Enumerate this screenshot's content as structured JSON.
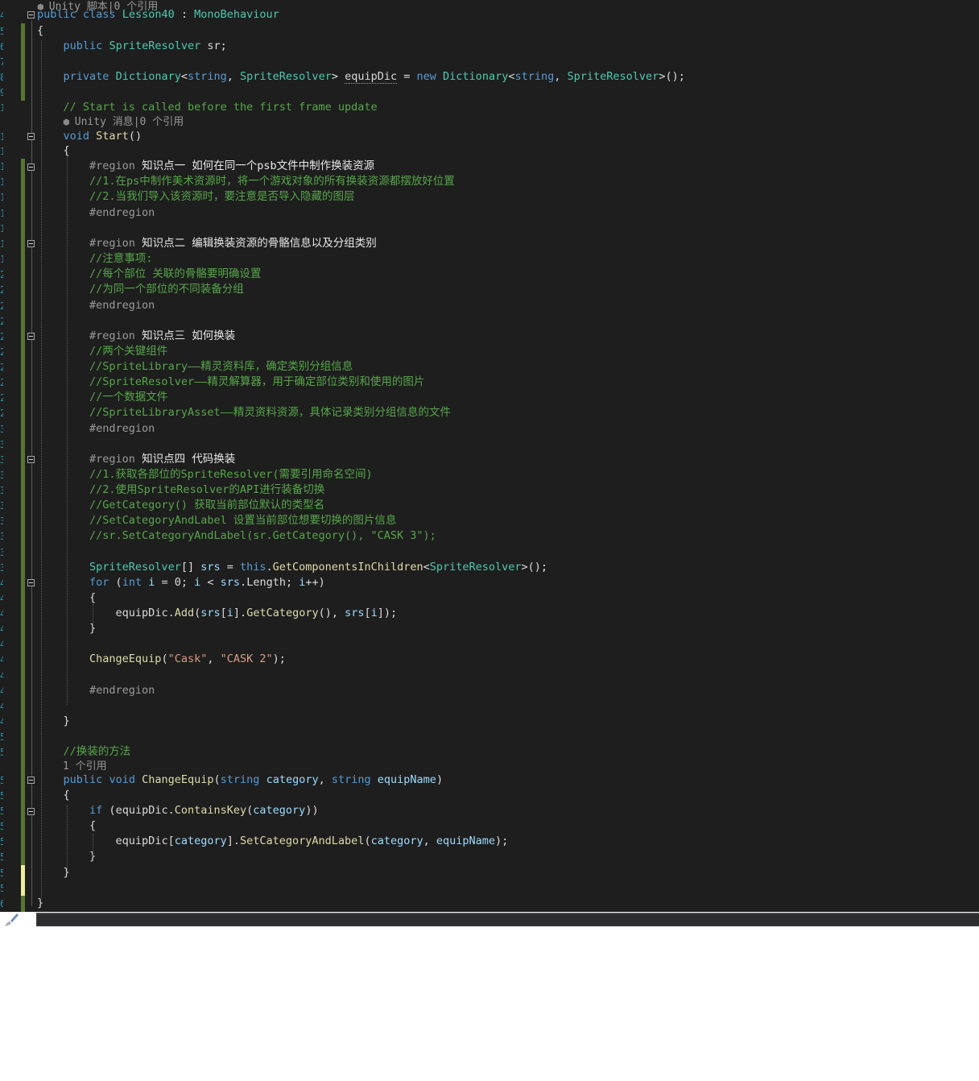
{
  "editor": {
    "language": "C#",
    "theme": "dark",
    "lines": [
      {
        "lens": "Unity 脚本|0 个引用"
      },
      {
        "tokens": [
          [
            "kw",
            "public"
          ],
          [
            "",
            " "
          ],
          [
            "kw",
            "class"
          ],
          [
            "",
            " "
          ],
          [
            "ty",
            "Lesson40"
          ],
          [
            "",
            " : "
          ],
          [
            "ty",
            "MonoBehaviour"
          ]
        ]
      },
      {
        "tokens": [
          [
            "",
            "{"
          ]
        ]
      },
      {
        "tokens": [
          [
            "",
            "    "
          ],
          [
            "kw",
            "public"
          ],
          [
            "",
            " "
          ],
          [
            "ty",
            "SpriteResolver"
          ],
          [
            "",
            " "
          ],
          [
            "fd",
            "sr"
          ],
          [
            "",
            ";"
          ]
        ]
      },
      {
        "tokens": []
      },
      {
        "tokens": [
          [
            "",
            "    "
          ],
          [
            "kw",
            "private"
          ],
          [
            "",
            " "
          ],
          [
            "ty",
            "Dictionary"
          ],
          [
            "",
            "<"
          ],
          [
            "kw",
            "string"
          ],
          [
            "",
            ", "
          ],
          [
            "ty",
            "SpriteResolver"
          ],
          [
            "",
            "> "
          ],
          [
            "fd",
            "equipDic"
          ],
          [
            "",
            " = "
          ],
          [
            "kw",
            "new"
          ],
          [
            "",
            " "
          ],
          [
            "ty",
            "Dictionary"
          ],
          [
            "",
            "<"
          ],
          [
            "kw",
            "string"
          ],
          [
            "",
            ", "
          ],
          [
            "ty",
            "SpriteResolver"
          ],
          [
            "",
            ">();"
          ]
        ]
      },
      {
        "tokens": []
      },
      {
        "tokens": [
          [
            "",
            "    "
          ],
          [
            "cm",
            "// Start is called before the first frame update"
          ]
        ]
      },
      {
        "lens": "Unity 消息|0 个引用"
      },
      {
        "tokens": [
          [
            "",
            "    "
          ],
          [
            "kw",
            "void"
          ],
          [
            "",
            " "
          ],
          [
            "mt",
            "Start"
          ],
          [
            "",
            "()"
          ]
        ]
      },
      {
        "tokens": [
          [
            "",
            "    {"
          ]
        ]
      },
      {
        "tokens": [
          [
            "",
            "        "
          ],
          [
            "pp",
            "#region"
          ],
          [
            "",
            " "
          ],
          [
            "reg",
            "知识点一 如何在同一个psb文件中制作换装资源"
          ]
        ]
      },
      {
        "tokens": [
          [
            "",
            "        "
          ],
          [
            "cm",
            "//1.在ps中制作美术资源时，将一个游戏对象的所有换装资源都摆放好位置"
          ]
        ]
      },
      {
        "tokens": [
          [
            "",
            "        "
          ],
          [
            "cm",
            "//2.当我们导入该资源时，要注意是否导入隐藏的图层"
          ]
        ]
      },
      {
        "tokens": [
          [
            "",
            "        "
          ],
          [
            "pp",
            "#endregion"
          ]
        ]
      },
      {
        "tokens": []
      },
      {
        "tokens": [
          [
            "",
            "        "
          ],
          [
            "pp",
            "#region"
          ],
          [
            "",
            " "
          ],
          [
            "reg",
            "知识点二 编辑换装资源的骨骼信息以及分组类别"
          ]
        ]
      },
      {
        "tokens": [
          [
            "",
            "        "
          ],
          [
            "cm",
            "//注意事项:"
          ]
        ]
      },
      {
        "tokens": [
          [
            "",
            "        "
          ],
          [
            "cm",
            "//每个部位 关联的骨骼要明确设置"
          ]
        ]
      },
      {
        "tokens": [
          [
            "",
            "        "
          ],
          [
            "cm",
            "//为同一个部位的不同装备分组"
          ]
        ]
      },
      {
        "tokens": [
          [
            "",
            "        "
          ],
          [
            "pp",
            "#endregion"
          ]
        ]
      },
      {
        "tokens": []
      },
      {
        "tokens": [
          [
            "",
            "        "
          ],
          [
            "pp",
            "#region"
          ],
          [
            "",
            " "
          ],
          [
            "reg",
            "知识点三 如何换装"
          ]
        ]
      },
      {
        "tokens": [
          [
            "",
            "        "
          ],
          [
            "cm",
            "//两个关键组件"
          ]
        ]
      },
      {
        "tokens": [
          [
            "",
            "        "
          ],
          [
            "cm",
            "//SpriteLibrary——精灵资料库，确定类别分组信息"
          ]
        ]
      },
      {
        "tokens": [
          [
            "",
            "        "
          ],
          [
            "cm",
            "//SpriteResolver——精灵解算器，用于确定部位类别和使用的图片"
          ]
        ]
      },
      {
        "tokens": [
          [
            "",
            "        "
          ],
          [
            "cm",
            "//一个数据文件"
          ]
        ]
      },
      {
        "tokens": [
          [
            "",
            "        "
          ],
          [
            "cm",
            "//SpriteLibraryAsset——精灵资料资源，具体记录类别分组信息的文件"
          ]
        ]
      },
      {
        "tokens": [
          [
            "",
            "        "
          ],
          [
            "pp",
            "#endregion"
          ]
        ]
      },
      {
        "tokens": []
      },
      {
        "tokens": [
          [
            "",
            "        "
          ],
          [
            "pp",
            "#region"
          ],
          [
            "",
            " "
          ],
          [
            "reg",
            "知识点四 代码换装"
          ]
        ]
      },
      {
        "tokens": [
          [
            "",
            "        "
          ],
          [
            "cm",
            "//1.获取各部位的SpriteResolver(需要引用命名空间)"
          ]
        ]
      },
      {
        "tokens": [
          [
            "",
            "        "
          ],
          [
            "cm",
            "//2.使用SpriteResolver的API进行装备切换"
          ]
        ]
      },
      {
        "tokens": [
          [
            "",
            "        "
          ],
          [
            "cm",
            "//GetCategory() 获取当前部位默认的类型名"
          ]
        ]
      },
      {
        "tokens": [
          [
            "",
            "        "
          ],
          [
            "cm",
            "//SetCategoryAndLabel 设置当前部位想要切换的图片信息"
          ]
        ]
      },
      {
        "tokens": [
          [
            "",
            "        "
          ],
          [
            "cm",
            "//sr.SetCategoryAndLabel(sr.GetCategory(), \"CASK 3\");"
          ]
        ]
      },
      {
        "tokens": []
      },
      {
        "tokens": [
          [
            "",
            "        "
          ],
          [
            "ty",
            "SpriteResolver"
          ],
          [
            "",
            "[] "
          ],
          [
            "pa",
            "srs"
          ],
          [
            "",
            " = "
          ],
          [
            "kw",
            "this"
          ],
          [
            "",
            "."
          ],
          [
            "mt",
            "GetComponentsInChildren"
          ],
          [
            "",
            "<"
          ],
          [
            "ty",
            "SpriteResolver"
          ],
          [
            "",
            ">();"
          ]
        ]
      },
      {
        "tokens": [
          [
            "",
            "        "
          ],
          [
            "kw",
            "for"
          ],
          [
            "",
            " ("
          ],
          [
            "kw",
            "int"
          ],
          [
            "",
            " "
          ],
          [
            "pa",
            "i"
          ],
          [
            "",
            " = 0; "
          ],
          [
            "pa",
            "i"
          ],
          [
            "",
            " < "
          ],
          [
            "pa",
            "srs"
          ],
          [
            "",
            ".Length; "
          ],
          [
            "pa",
            "i"
          ],
          [
            "",
            "++)"
          ]
        ]
      },
      {
        "tokens": [
          [
            "",
            "        {"
          ]
        ]
      },
      {
        "tokens": [
          [
            "",
            "            "
          ],
          [
            "fd",
            "equipDic"
          ],
          [
            "",
            "."
          ],
          [
            "mt",
            "Add"
          ],
          [
            "",
            "("
          ],
          [
            "pa",
            "srs"
          ],
          [
            "",
            "["
          ],
          [
            "pa",
            "i"
          ],
          [
            "",
            "]."
          ],
          [
            "mt",
            "GetCategory"
          ],
          [
            "",
            "(), "
          ],
          [
            "pa",
            "srs"
          ],
          [
            "",
            "["
          ],
          [
            "pa",
            "i"
          ],
          [
            "",
            "]);"
          ]
        ]
      },
      {
        "tokens": [
          [
            "",
            "        }"
          ]
        ]
      },
      {
        "tokens": []
      },
      {
        "tokens": [
          [
            "",
            "        "
          ],
          [
            "mt",
            "ChangeEquip"
          ],
          [
            "",
            "("
          ],
          [
            "st",
            "\"Cask\""
          ],
          [
            "",
            ", "
          ],
          [
            "st",
            "\"CASK 2\""
          ],
          [
            "",
            ");"
          ]
        ]
      },
      {
        "tokens": []
      },
      {
        "tokens": [
          [
            "",
            "        "
          ],
          [
            "pp",
            "#endregion"
          ]
        ]
      },
      {
        "tokens": []
      },
      {
        "tokens": [
          [
            "",
            "    }"
          ]
        ]
      },
      {
        "tokens": []
      },
      {
        "tokens": [
          [
            "",
            "    "
          ],
          [
            "cm",
            "//换装的方法"
          ]
        ]
      },
      {
        "lens": "1 个引用"
      },
      {
        "tokens": [
          [
            "",
            "    "
          ],
          [
            "kw",
            "public"
          ],
          [
            "",
            " "
          ],
          [
            "kw",
            "void"
          ],
          [
            "",
            " "
          ],
          [
            "mt",
            "ChangeEquip"
          ],
          [
            "",
            "("
          ],
          [
            "kw",
            "string"
          ],
          [
            "",
            " "
          ],
          [
            "pa",
            "category"
          ],
          [
            "",
            ", "
          ],
          [
            "kw",
            "string"
          ],
          [
            "",
            " "
          ],
          [
            "pa",
            "equipName"
          ],
          [
            "",
            ")"
          ]
        ]
      },
      {
        "tokens": [
          [
            "",
            "    {"
          ]
        ]
      },
      {
        "tokens": [
          [
            "",
            "        "
          ],
          [
            "kw",
            "if"
          ],
          [
            "",
            " ("
          ],
          [
            "fd",
            "equipDic"
          ],
          [
            "",
            "."
          ],
          [
            "mt",
            "ContainsKey"
          ],
          [
            "",
            "("
          ],
          [
            "pa",
            "category"
          ],
          [
            "",
            "))"
          ]
        ]
      },
      {
        "tokens": [
          [
            "",
            "        {"
          ]
        ]
      },
      {
        "tokens": [
          [
            "",
            "            "
          ],
          [
            "fd",
            "equipDic"
          ],
          [
            "",
            "["
          ],
          [
            "pa",
            "category"
          ],
          [
            "",
            "]."
          ],
          [
            "mt",
            "SetCategoryAndLabel"
          ],
          [
            "",
            "("
          ],
          [
            "pa",
            "category"
          ],
          [
            "",
            ", "
          ],
          [
            "pa",
            "equipName"
          ],
          [
            "",
            ");"
          ]
        ]
      },
      {
        "tokens": [
          [
            "",
            "        }"
          ]
        ]
      },
      {
        "tokens": [
          [
            "",
            "    }"
          ]
        ]
      },
      {
        "tokens": []
      },
      {
        "tokens": [
          [
            "",
            "}"
          ]
        ]
      }
    ]
  },
  "colors": {
    "background": "#1e1e1e",
    "keyword": "#569cd6",
    "type": "#4ec9b0",
    "comment": "#57a64a",
    "string": "#d69d85",
    "method": "#dcdcaa",
    "parameter": "#9cdcfe",
    "saved_change": "#577430",
    "unsaved_change": "#efeb9c"
  },
  "icons": {
    "lens": "unity-cube-icon",
    "status": "brush-icon"
  }
}
